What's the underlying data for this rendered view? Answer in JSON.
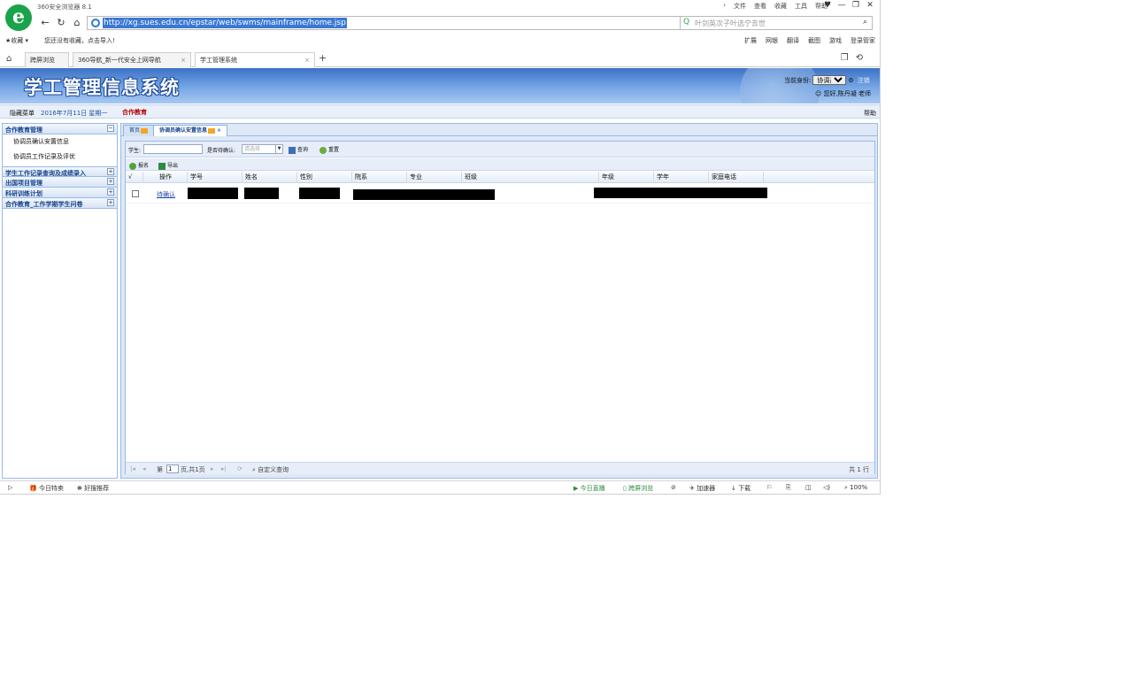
{
  "browser": {
    "app_title": "360安全浏览器 8.1",
    "menus": [
      "文件",
      "查看",
      "收藏",
      "工具",
      "帮助"
    ],
    "url": "http://xg.sues.edu.cn/epstar/web/swms/mainframe/home.jsp",
    "search_placeholder": "叶剑英次子叶选宁去世",
    "favorites_label": "收藏",
    "favorites_hint": "您还没有收藏，点击导入!",
    "toolbar_items": [
      "扩展",
      "网银",
      "翻译",
      "截图",
      "游戏",
      "登录管家"
    ],
    "tabs": [
      {
        "label": "跨屏浏览"
      },
      {
        "label": "360导航_新一代安全上网导航"
      },
      {
        "label": "学工管理系统"
      }
    ]
  },
  "app": {
    "system_name": "学工管理信息系统",
    "identity_label": "当前身份:",
    "identity_value": "协调员",
    "logout": "注销",
    "greeting": "您好,陈丹凝 老师",
    "subnav": {
      "hide_menu": "隐藏菜单",
      "date": "2016年7月11日 星期一",
      "active_module": "合作教育",
      "help": "帮助"
    },
    "sidebar": {
      "groups": [
        {
          "title": "合作教育管理",
          "toggle": "−",
          "items": [
            "协调员确认安置信息",
            "协调员工作记录及评优"
          ]
        },
        {
          "title": "学生工作记录查询及成绩录入",
          "toggle": "+"
        },
        {
          "title": "出国项目管理",
          "toggle": "+"
        },
        {
          "title": "科研训练计划",
          "toggle": "+"
        },
        {
          "title": "合作教育_工作学期学生问卷",
          "toggle": "+"
        }
      ]
    },
    "panel_tabs": [
      {
        "label": "首页"
      },
      {
        "label": "协调员确认安置信息"
      }
    ],
    "query": {
      "student_label": "学生:",
      "confirm_label": "是否待确认:",
      "select_placeholder": "请选择",
      "search_button": "查询",
      "reset_button": "重置"
    },
    "toolbar": {
      "enroll": "报名",
      "export": "导出"
    },
    "table": {
      "columns": [
        "√",
        "操作",
        "学号",
        "姓名",
        "性别",
        "院系",
        "专业",
        "班级",
        "年级",
        "学年",
        "家庭电话"
      ],
      "rows": [
        {
          "operation": "待确认"
        }
      ]
    },
    "pager": {
      "page_prefix": "第",
      "page_value": "1",
      "page_suffix": "页,共1页",
      "custom_query": "自定义查询",
      "total": "共 1 行"
    }
  },
  "status_bar": {
    "left_items": [
      "今日特卖",
      "好搜推荐"
    ],
    "right_items": [
      "今日直播",
      "跨屏浏览",
      "加速器",
      "下载"
    ],
    "zoom": "100%"
  }
}
